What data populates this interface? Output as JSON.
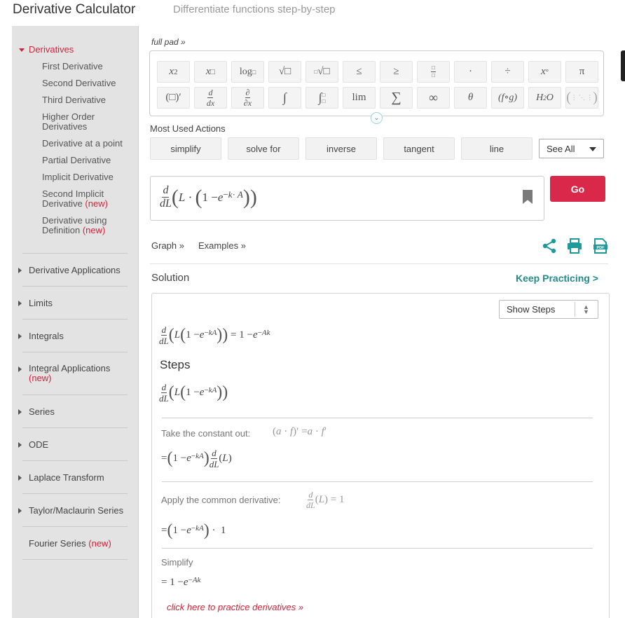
{
  "header": {
    "title": "Derivative Calculator",
    "subtitle": "Differentiate functions step-by-step"
  },
  "sidebar": {
    "derivatives": {
      "label": "Derivatives",
      "items": [
        {
          "label": "First Derivative"
        },
        {
          "label": "Second Derivative"
        },
        {
          "label": "Third Derivative"
        },
        {
          "label": "Higher Order Derivatives"
        },
        {
          "label": "Derivative at a point"
        },
        {
          "label": "Partial Derivative"
        },
        {
          "label": "Implicit Derivative"
        },
        {
          "label": "Second Implicit Derivative",
          "badge": "(new)"
        },
        {
          "label": "Derivative using Definition",
          "badge": "(new)"
        }
      ]
    },
    "sections": [
      {
        "label": "Derivative Applications"
      },
      {
        "label": "Limits"
      },
      {
        "label": "Integrals"
      },
      {
        "label": "Integral Applications",
        "badge": "(new)"
      },
      {
        "label": "Series"
      },
      {
        "label": "ODE"
      },
      {
        "label": "Laplace Transform"
      },
      {
        "label": "Taylor/Maclaurin Series"
      },
      {
        "label": "Fourier Series",
        "badge": "(new)"
      }
    ]
  },
  "keypad": {
    "full_pad_label": "full pad »",
    "row1": [
      "x²",
      "x□",
      "log□",
      "√□",
      "∛□",
      "≤",
      "≥",
      "□/□",
      "·",
      "÷",
      "x°",
      "π"
    ],
    "row2": [
      "(□)′",
      "d/dx",
      "∂/∂x",
      "∫",
      "∫□□",
      "lim",
      "∑",
      "∞",
      "θ",
      "(f∘g)",
      "H₂O",
      "matrix"
    ]
  },
  "actions": {
    "label": "Most Used Actions",
    "buttons": [
      "simplify",
      "solve for",
      "inverse",
      "tangent",
      "line"
    ],
    "see_all": "See All"
  },
  "input": {
    "expression": "d/dL ( L · ( 1 − e^(−k·A) ) )",
    "go_label": "Go"
  },
  "links": {
    "graph": "Graph »",
    "examples": "Examples »"
  },
  "solution": {
    "label": "Solution",
    "keep_practicing": "Keep Practicing >",
    "show_steps": "Show Steps",
    "result": "d/dL (L(1 − e^(−kA))) = 1 − e^(−Ak)",
    "steps_title": "Steps",
    "steps": [
      {
        "label": "Take the constant out:",
        "rule": "(a · f)′ = a · f′"
      },
      {
        "label": "Apply the common derivative:",
        "rule": "d/dL (L) = 1"
      },
      {
        "label": "Simplify"
      }
    ],
    "practice_link": "click here to practice derivatives »"
  },
  "colors": {
    "brand_red": "#d9284a",
    "teal": "#268a8a",
    "sidebar_bg": "#e3e3e3"
  }
}
